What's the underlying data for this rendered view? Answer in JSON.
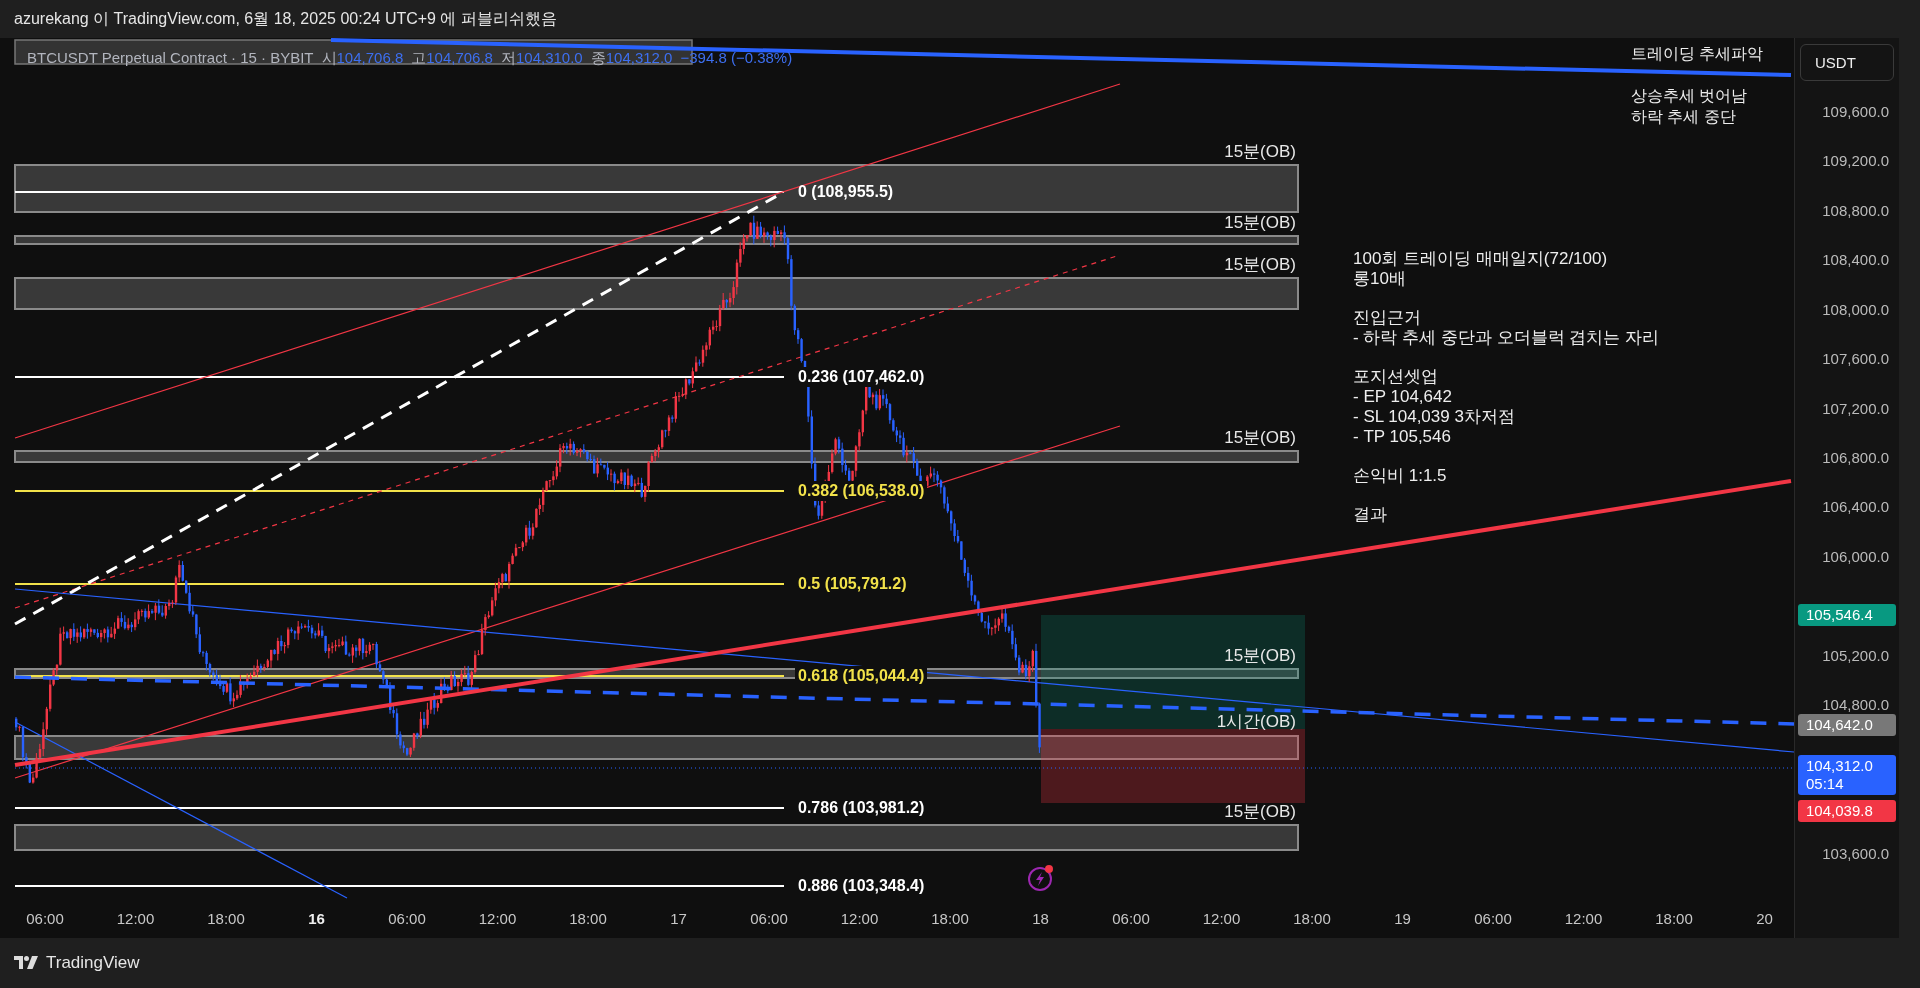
{
  "header": {
    "publisher_line": "azurekang 이 TradingView.com, 6월 18, 2025 00:24 UTC+9 에 퍼블리쉬했음"
  },
  "legend": {
    "symbol": "BTCUSDT Perpetual Contract · 15 · BYBIT",
    "values": [
      {
        "label": "시",
        "value": "104,706.8"
      },
      {
        "label": "고",
        "value": "104,706.8"
      },
      {
        "label": "저",
        "value": "104,310.0"
      },
      {
        "label": "종",
        "value": "104,312.0"
      }
    ],
    "change": "−394.8 (−0.38%)"
  },
  "currency_button": "USDT",
  "trend_notes": {
    "title": "트레이딩 추세파악",
    "lines": [
      "상승추세 벗어남",
      "하락 추세 중단"
    ]
  },
  "journal": [
    [
      "100회 트레이딩 매매일지(72/100)",
      "롱10배"
    ],
    [
      "진입근거",
      "- 하락 추세 중단과 오더블럭 겹치는 자리"
    ],
    [
      "포지션셋업",
      "- EP 104,642",
      "- SL 104,039 3차저점",
      "- TP 105,546"
    ],
    [
      "손익비 1:1.5"
    ],
    [
      "결과"
    ]
  ],
  "order_block_labels": [
    "15분(OB)",
    "15분(OB)",
    "15분(OB)",
    "15분(OB)",
    "15분(OB)",
    "1시간(OB)",
    "15분(OB)"
  ],
  "fib_levels": [
    {
      "label": "0 (108,955.5)",
      "color": "#ffffff"
    },
    {
      "label": "0.236 (107,462.0)",
      "color": "#ffffff"
    },
    {
      "label": "0.382 (106,538.0)",
      "color": "#f2e24a"
    },
    {
      "label": "0.5 (105,791.2)",
      "color": "#f2e24a"
    },
    {
      "label": "0.618 (105,044.4)",
      "color": "#f2e24a"
    },
    {
      "label": "0.786 (103,981.2)",
      "color": "#ffffff"
    },
    {
      "label": "0.886 (103,348.4)",
      "color": "#ffffff"
    }
  ],
  "price_axis": {
    "labels": [
      "109,600.0",
      "109,200.0",
      "108,800.0",
      "108,400.0",
      "108,000.0",
      "107,600.0",
      "107,200.0",
      "106,800.0",
      "106,400.0",
      "106,000.0",
      "105,200.0",
      "104,800.0",
      "103,600.0"
    ],
    "markers": [
      {
        "text": "105,546.4",
        "color": "#089981"
      },
      {
        "text": "104,642.0",
        "color": "#787878"
      },
      {
        "text": "104,312.0",
        "countdown": "05:14",
        "color": "#2962ff"
      },
      {
        "text": "104,039.8",
        "color": "#f23645"
      }
    ]
  },
  "time_axis": [
    {
      "label": "06:00",
      "bold": false
    },
    {
      "label": "12:00",
      "bold": false
    },
    {
      "label": "18:00",
      "bold": false
    },
    {
      "label": "16",
      "bold": true
    },
    {
      "label": "06:00",
      "bold": false
    },
    {
      "label": "12:00",
      "bold": false
    },
    {
      "label": "18:00",
      "bold": false
    },
    {
      "label": "17",
      "bold": false
    },
    {
      "label": "06:00",
      "bold": false
    },
    {
      "label": "12:00",
      "bold": false
    },
    {
      "label": "18:00",
      "bold": false
    },
    {
      "label": "18",
      "bold": false
    },
    {
      "label": "06:00",
      "bold": false
    },
    {
      "label": "12:00",
      "bold": false
    },
    {
      "label": "18:00",
      "bold": false
    },
    {
      "label": "19",
      "bold": false
    },
    {
      "label": "06:00",
      "bold": false
    },
    {
      "label": "12:00",
      "bold": false
    },
    {
      "label": "18:00",
      "bold": false
    },
    {
      "label": "20",
      "bold": false
    }
  ],
  "footer": {
    "brand": "TradingView"
  }
}
